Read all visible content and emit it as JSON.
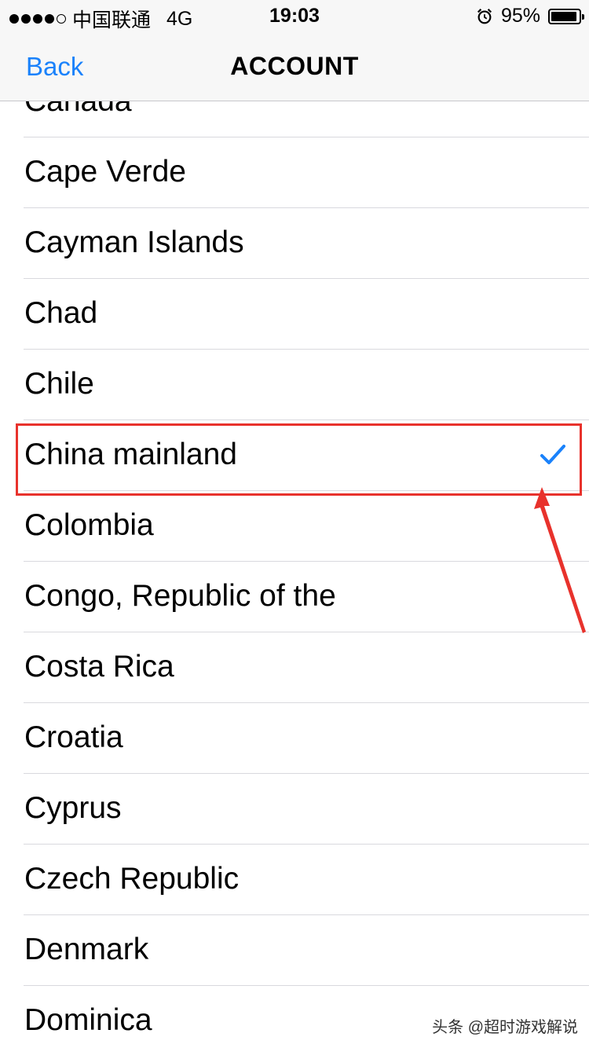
{
  "status_bar": {
    "carrier": "中国联通",
    "network": "4G",
    "time": "19:03",
    "battery": "95%",
    "battery_level": 0.95
  },
  "nav": {
    "back_label": "Back",
    "title": "ACCOUNT"
  },
  "countries": [
    {
      "label": "Canada",
      "selected": false
    },
    {
      "label": "Cape Verde",
      "selected": false
    },
    {
      "label": "Cayman Islands",
      "selected": false
    },
    {
      "label": "Chad",
      "selected": false
    },
    {
      "label": "Chile",
      "selected": false
    },
    {
      "label": "China mainland",
      "selected": true
    },
    {
      "label": "Colombia",
      "selected": false
    },
    {
      "label": "Congo, Republic of the",
      "selected": false
    },
    {
      "label": "Costa Rica",
      "selected": false
    },
    {
      "label": "Croatia",
      "selected": false
    },
    {
      "label": "Cyprus",
      "selected": false
    },
    {
      "label": "Czech Republic",
      "selected": false
    },
    {
      "label": "Denmark",
      "selected": false
    },
    {
      "label": "Dominica",
      "selected": false
    }
  ],
  "icons": {
    "selected": "checkmark-icon",
    "alarm": "alarm-icon",
    "battery": "battery-icon"
  },
  "colors": {
    "accent": "#1a82fb",
    "annotation": "#e8322c"
  },
  "watermark": "头条 @超时游戏解说"
}
